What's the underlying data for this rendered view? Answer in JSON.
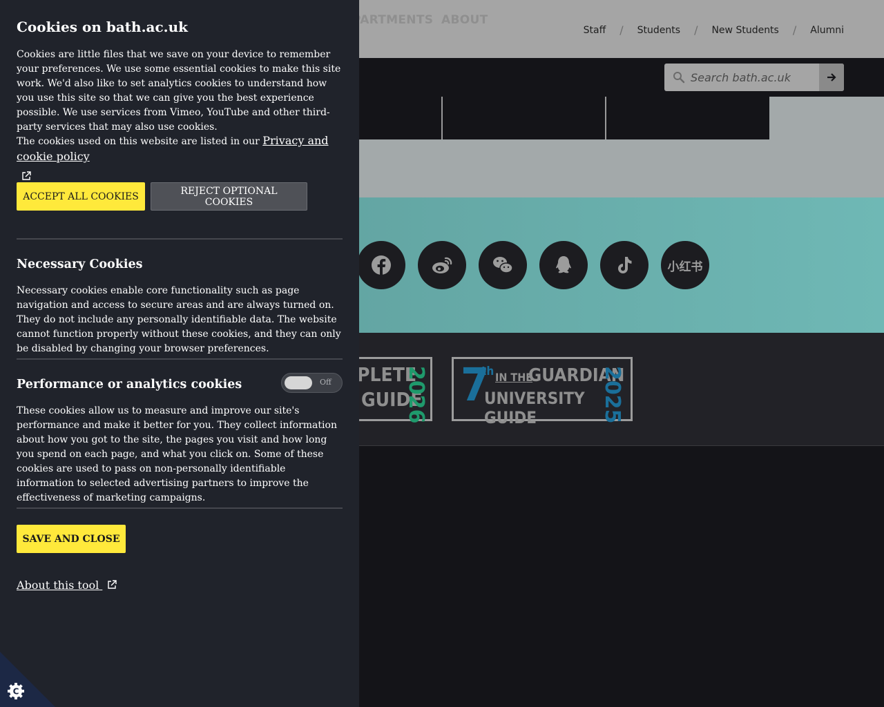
{
  "header": {
    "audience_links": [
      "Staff",
      "Students",
      "New Students",
      "Alumni"
    ],
    "audience_separator": "/"
  },
  "nav": {
    "items": [
      "PARTMENTS",
      "ABOUT"
    ]
  },
  "search": {
    "placeholder": "Search bath.ac.uk",
    "icon": "search-icon",
    "submit_icon": "arrow-right-icon"
  },
  "social": {
    "icons": [
      "facebook-icon",
      "weibo-icon",
      "wechat-icon",
      "qq-icon",
      "tiktok-icon",
      "xiaohongshu-icon"
    ],
    "xiaohongshu_label": "小红书"
  },
  "badges": {
    "complete": {
      "line1": "PLETE",
      "line2": "GUIDE",
      "year": "2026"
    },
    "guardian": {
      "rank": "7",
      "suffix": "th",
      "in_the": "IN THE",
      "line1": "GUARDIAN",
      "line2": "UNIVERSITY GUIDE",
      "year": "2025"
    }
  },
  "cookie_panel": {
    "title": "Cookies on bath.ac.uk",
    "intro": "Cookies are little files that we save on your device to remember your preferences. We use some essential cookies to make this site work. We'd also like to set analytics cookies to understand how you use this site so that we can give you the best experience possible. We use services from Vimeo, YouTube and other third-party services that may also use cookies.",
    "policy_text": "The cookies used on this website are listed in our ",
    "policy_link": "Privacy and cookie policy",
    "accept_label": "ACCEPT ALL COOKIES",
    "reject_label": "REJECT OPTIONAL COOKIES",
    "necessary": {
      "heading": "Necessary Cookies",
      "text": "Necessary cookies enable core functionality such as page navigation and access to secure areas and are always turned on. They do not include any personally identifiable data. The website cannot function properly without these cookies, and they can only be disabled by changing your browser preferences."
    },
    "performance": {
      "heading": "Performance or analytics cookies",
      "toggle_label": "Off",
      "toggle_on": false,
      "text": "These cookies allow us to measure and improve our site's performance and make it better for you. They collect information about how you got to the site, the pages you visit and how long you spend on each page, and what you click on. Some of these cookies are used to pass on non-personally identifiable information to selected advertising partners to improve the effectiveness of marketing campaigns."
    },
    "save_label": "SAVE AND CLOSE",
    "about_label": "About this tool"
  },
  "colors": {
    "accent_yellow": "#ffe93b",
    "panel_bg": "#20232b",
    "teal_band": "#5b9997",
    "badge_green": "#1f9a6c",
    "badge_blue": "#1a6f9a"
  }
}
